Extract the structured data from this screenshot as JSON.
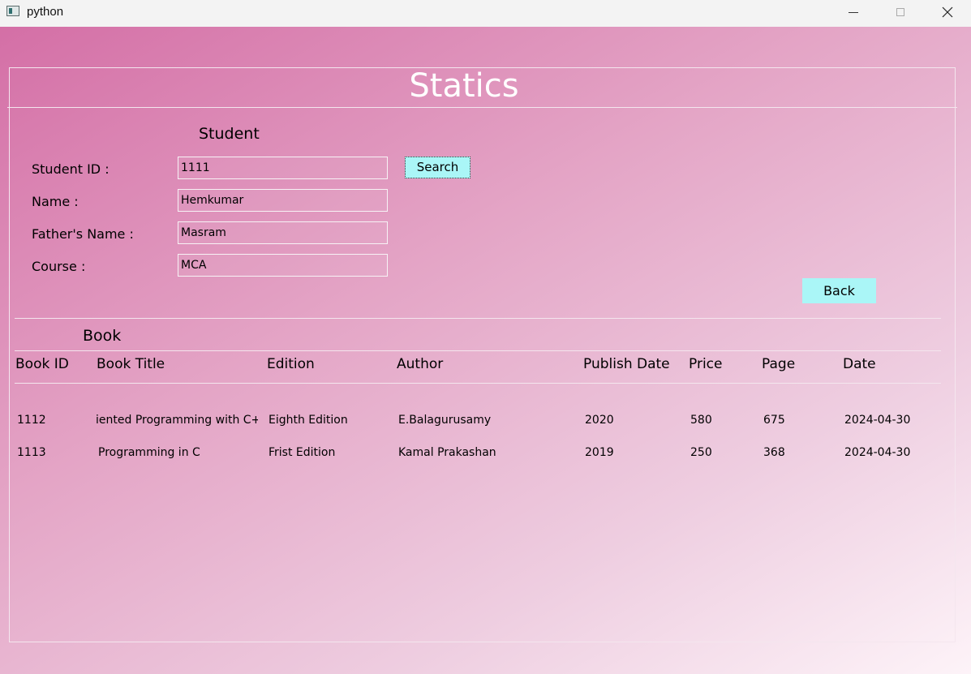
{
  "window": {
    "title": "python"
  },
  "page": {
    "title": "Statics"
  },
  "student": {
    "section_label": "Student",
    "id_label": "Student ID :",
    "id_value": "1111",
    "name_label": "Name :",
    "name_value": "Hemkumar",
    "father_label": "Father's Name :",
    "father_value": "Masram",
    "course_label": "Course :",
    "course_value": "MCA",
    "search_label": "Search",
    "back_label": "Back"
  },
  "book": {
    "section_label": "Book",
    "columns": [
      "Book ID",
      "Book Title",
      "Edition",
      "Author",
      "Publish Date",
      "Price",
      "Page",
      "Date"
    ],
    "rows": [
      [
        "1112",
        "iented Programming with C++",
        "Eighth Edition",
        "E.Balagurusamy",
        "2020",
        "580",
        "675",
        "2024-04-30"
      ],
      [
        "1113",
        "Programming in C",
        "Frist Edition",
        "Kamal Prakashan",
        "2019",
        "250",
        "368",
        "2024-04-30"
      ]
    ]
  },
  "colors": {
    "button_bg": "#aaf6f7",
    "gradient_start": "#d46fa6",
    "gradient_end": "#fdf3f8"
  },
  "icons": {
    "app": "app-icon",
    "minimize": "minimize-icon",
    "maximize": "maximize-icon",
    "close": "close-icon"
  }
}
